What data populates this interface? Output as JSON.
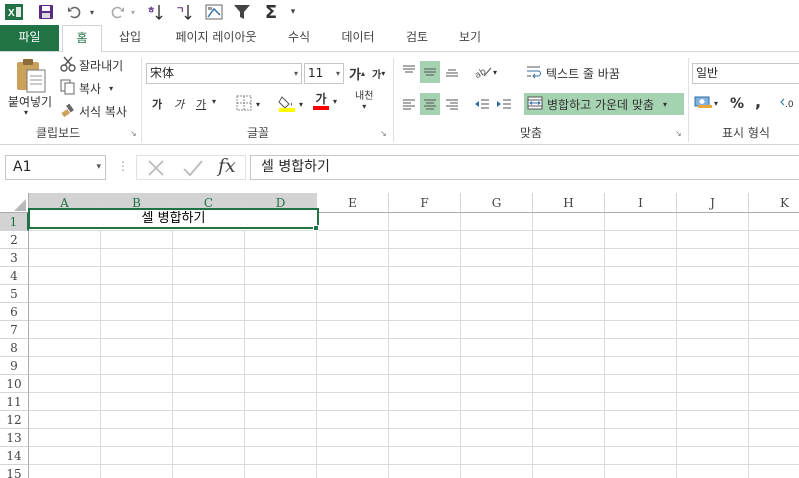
{
  "tabs": {
    "file": "파일",
    "home": "홈",
    "insert": "삽입",
    "page_layout": "페이지 레이아웃",
    "formulas": "수식",
    "data": "데이터",
    "review": "검토",
    "view": "보기"
  },
  "clipboard": {
    "paste": "붙여넣기",
    "cut": "잘라내기",
    "copy": "복사",
    "format_painter": "서식 복사",
    "label": "클립보드"
  },
  "font": {
    "name": "宋体",
    "size": "11",
    "grow": "가",
    "shrink": "가",
    "bold": "가",
    "italic": "가",
    "underline": "가",
    "font_color_letter": "가",
    "phonetic": "내천",
    "label": "글꼴"
  },
  "alignment": {
    "wrap_text": "텍스트 줄 바꿈",
    "merge_center": "병합하고 가운데 맞춤",
    "label": "맞춤"
  },
  "number": {
    "format": "일반",
    "percent": "%",
    "comma": ",",
    "label": "표시 형식"
  },
  "formula_bar": {
    "name_box": "A1",
    "fx": "fx",
    "content": "셀 병합하기"
  },
  "sheet": {
    "columns": [
      "A",
      "B",
      "C",
      "D",
      "E",
      "F",
      "G",
      "H",
      "I",
      "J",
      "K"
    ],
    "rows": [
      "1",
      "2",
      "3",
      "4",
      "5",
      "6",
      "7",
      "8",
      "9",
      "10",
      "11",
      "12",
      "13",
      "14",
      "15"
    ],
    "merged_text": "셀 병합하기"
  },
  "colors": {
    "accent": "#217346",
    "highlight": "#a5d3b2",
    "fill_yellow": "#ffff00",
    "font_red": "#ff0000"
  }
}
